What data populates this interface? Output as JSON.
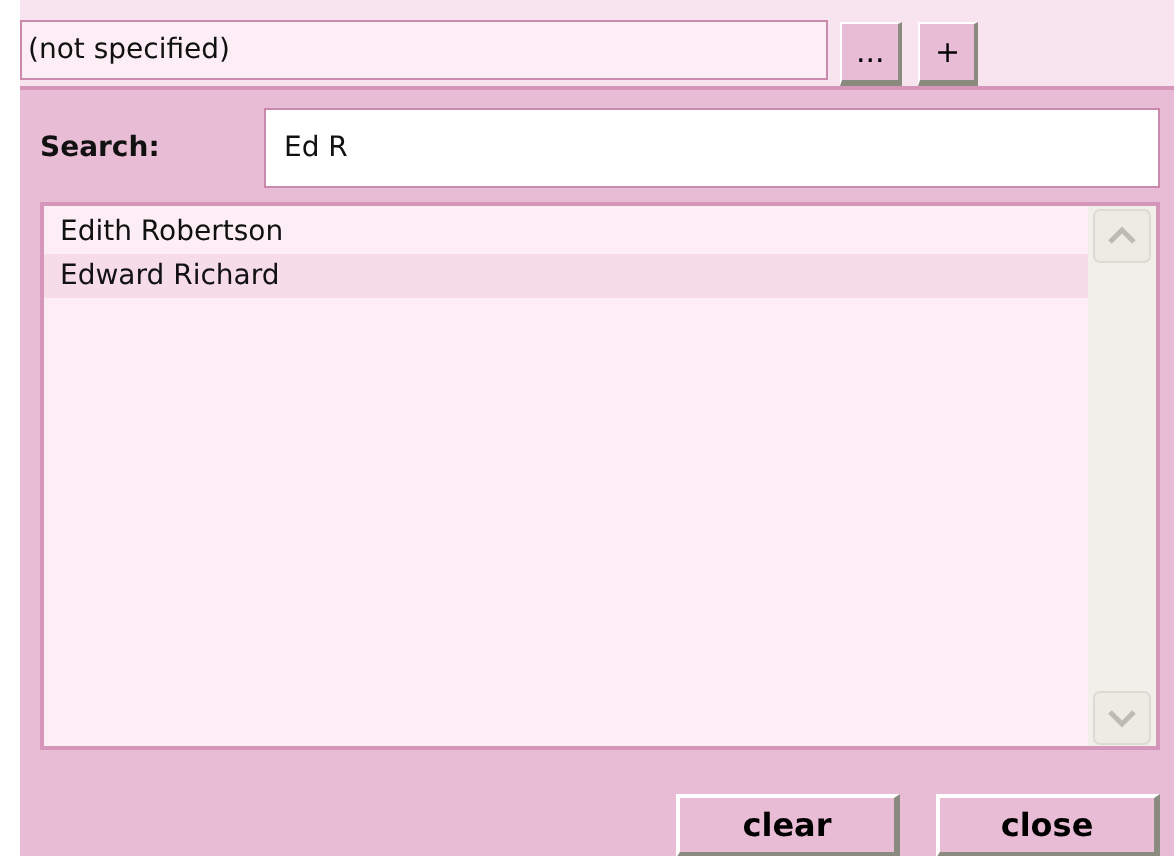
{
  "selector": {
    "value": "(not specified)",
    "buttons": [
      "...",
      "+"
    ]
  },
  "search": {
    "label": "Search:",
    "value": "Ed R"
  },
  "results": [
    {
      "name": "Edith Robertson",
      "selected": false
    },
    {
      "name": "Edward Richard",
      "selected": true
    }
  ],
  "actions": [
    "clear",
    "close"
  ]
}
